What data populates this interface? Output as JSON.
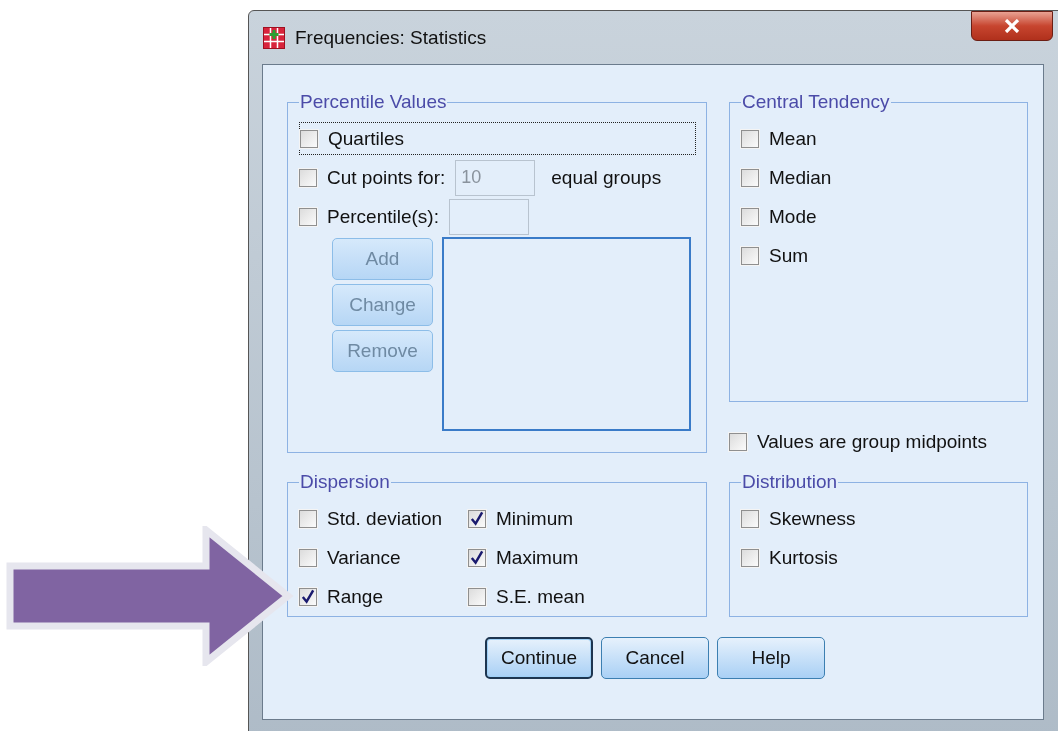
{
  "window": {
    "title": "Frequencies: Statistics"
  },
  "percentile_values": {
    "title": "Percentile Values",
    "quartiles": {
      "label": "Quartiles",
      "checked": false,
      "focused": true
    },
    "cut_points": {
      "label": "Cut points for:",
      "checked": false,
      "value": "10",
      "disabled": true,
      "suffix": "equal groups"
    },
    "percentiles": {
      "label": "Percentile(s):",
      "checked": false,
      "disabled": true
    },
    "buttons": [
      {
        "label": "Add",
        "disabled": true
      },
      {
        "label": "Change",
        "disabled": true
      },
      {
        "label": "Remove",
        "disabled": true
      }
    ]
  },
  "central_tendency": {
    "title": "Central Tendency",
    "options": [
      {
        "label": "Mean",
        "checked": false
      },
      {
        "label": "Median",
        "checked": false
      },
      {
        "label": "Mode",
        "checked": false
      },
      {
        "label": "Sum",
        "checked": false
      }
    ]
  },
  "values_group_midpoints": {
    "label": "Values are group midpoints",
    "checked": false
  },
  "dispersion": {
    "title": "Dispersion",
    "options": [
      {
        "label": "Std. deviation",
        "checked": false
      },
      {
        "label": "Minimum",
        "checked": true
      },
      {
        "label": "Variance",
        "checked": false
      },
      {
        "label": "Maximum",
        "checked": true
      },
      {
        "label": "Range",
        "checked": true
      },
      {
        "label": "S.E. mean",
        "checked": false
      }
    ]
  },
  "distribution": {
    "title": "Distribution",
    "options": [
      {
        "label": "Skewness",
        "checked": false
      },
      {
        "label": "Kurtosis",
        "checked": false
      }
    ]
  },
  "buttons": [
    {
      "label": "Continue",
      "default": true
    },
    {
      "label": "Cancel",
      "default": false
    },
    {
      "label": "Help",
      "default": false
    }
  ]
}
